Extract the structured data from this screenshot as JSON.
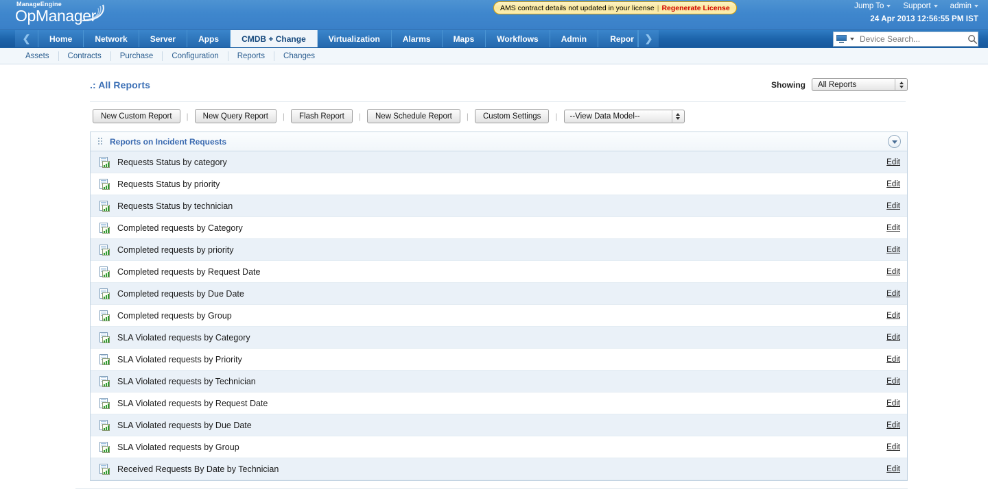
{
  "header": {
    "logo_brand": "ManageEngine",
    "logo_product": "OpManager",
    "license_notice": "AMS contract details not updated in your license",
    "license_separator": "|",
    "license_action": "Regenerate License",
    "links": [
      {
        "label": "Jump To",
        "icon": "chevron-down-icon"
      },
      {
        "label": "Support",
        "icon": "chevron-down-icon"
      },
      {
        "label": "admin",
        "icon": "chevron-down-icon"
      }
    ],
    "datetime": "24 Apr 2013 12:56:55 PM IST"
  },
  "nav": {
    "prev_arrow": "❮",
    "next_arrow": "❯",
    "tabs": [
      {
        "label": "Home",
        "active": false
      },
      {
        "label": "Network",
        "active": false
      },
      {
        "label": "Server",
        "active": false
      },
      {
        "label": "Apps",
        "active": false
      },
      {
        "label": "CMDB + Change",
        "active": true
      },
      {
        "label": "Virtualization",
        "active": false
      },
      {
        "label": "Alarms",
        "active": false
      },
      {
        "label": "Maps",
        "active": false
      },
      {
        "label": "Workflows",
        "active": false
      },
      {
        "label": "Admin",
        "active": false
      },
      {
        "label": "Repor",
        "active": false
      }
    ]
  },
  "search": {
    "placeholder": "Device Search...",
    "value": "",
    "scope_icon": "monitor-icon",
    "submit_icon": "search-icon"
  },
  "subnav": {
    "items": [
      {
        "label": "Assets"
      },
      {
        "label": "Contracts"
      },
      {
        "label": "Purchase"
      },
      {
        "label": "Configuration"
      },
      {
        "label": "Reports"
      },
      {
        "label": "Changes"
      }
    ]
  },
  "page": {
    "title": ".: All Reports",
    "showing_label": "Showing",
    "showing_value": "All Reports"
  },
  "toolbar": {
    "buttons": [
      {
        "label": "New Custom Report"
      },
      {
        "label": "New Query Report"
      },
      {
        "label": "Flash Report"
      },
      {
        "label": "New Schedule Report"
      },
      {
        "label": "Custom Settings"
      }
    ],
    "separator": "|",
    "data_model_value": "--View Data Model--"
  },
  "panel": {
    "title": "Reports on Incident Requests",
    "grip_icon": "drag-grip-icon",
    "collapse_icon": "chevron-down-icon",
    "row_action_label": "Edit",
    "row_icon": "report-document-icon",
    "rows": [
      {
        "label": "Requests Status by category"
      },
      {
        "label": "Requests Status by priority"
      },
      {
        "label": "Requests Status by technician"
      },
      {
        "label": "Completed requests by Category"
      },
      {
        "label": "Completed requests by priority"
      },
      {
        "label": "Completed requests by Request Date"
      },
      {
        "label": "Completed requests by Due Date"
      },
      {
        "label": "Completed requests by Group"
      },
      {
        "label": "SLA Violated requests by Category"
      },
      {
        "label": "SLA Violated requests by Priority"
      },
      {
        "label": "SLA Violated requests by Technician"
      },
      {
        "label": "SLA Violated requests by Request Date"
      },
      {
        "label": "SLA Violated requests by Due Date"
      },
      {
        "label": "SLA Violated requests by Group"
      },
      {
        "label": "Received Requests By Date by Technician"
      }
    ]
  },
  "colors": {
    "brand_blue": "#3a80c8",
    "nav_blue": "#1d64ab",
    "accent_link": "#3b6fb5",
    "alert_red": "#d10000",
    "row_alt": "#eaf1f8"
  }
}
